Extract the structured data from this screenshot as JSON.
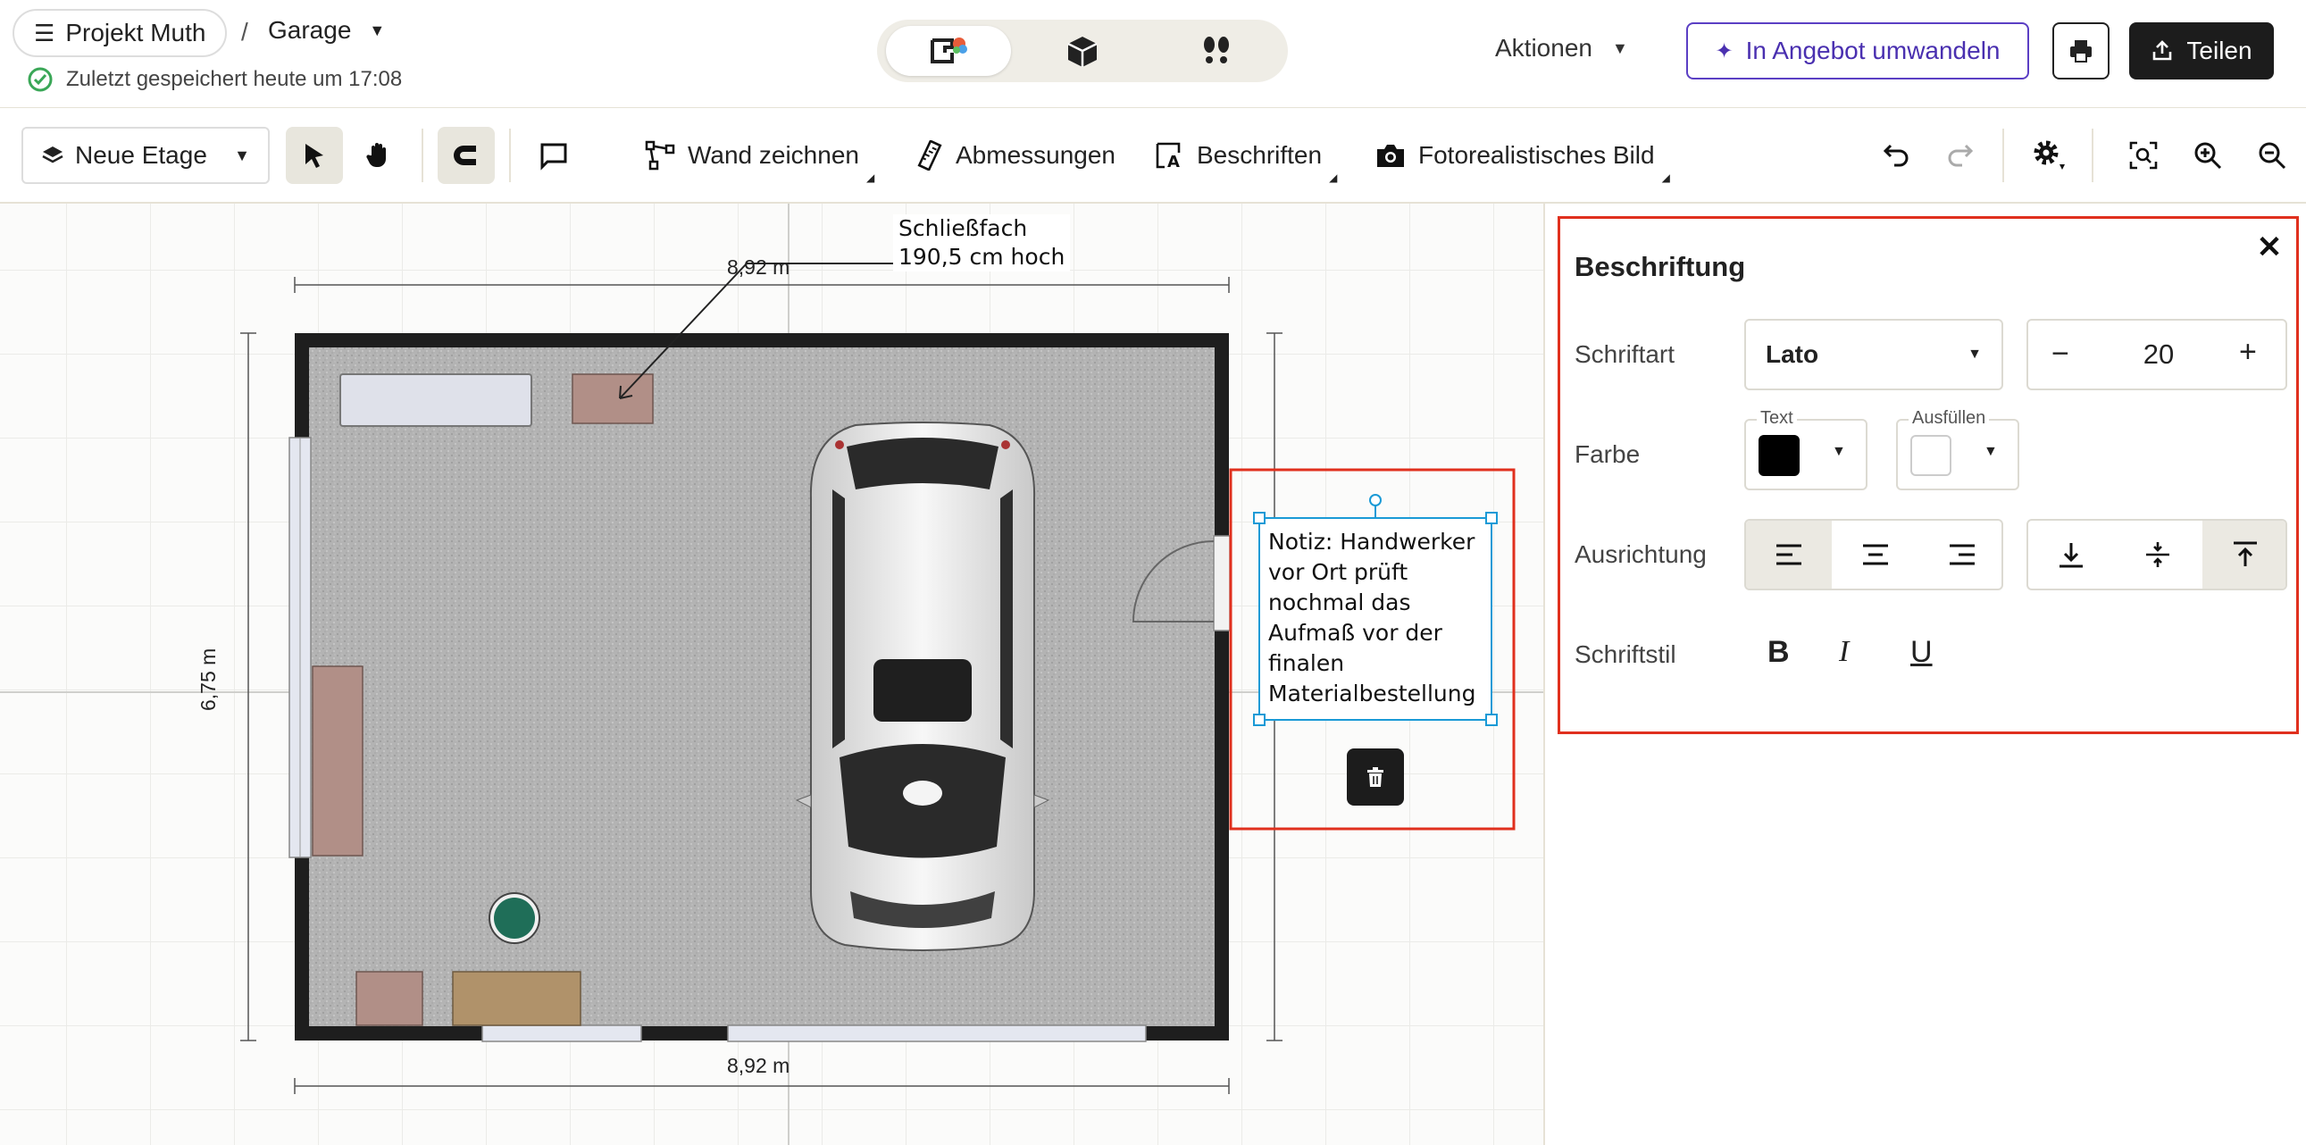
{
  "header": {
    "project": "Projekt Muth",
    "separator": "/",
    "room": "Garage",
    "save_status": "Zuletzt gespeichert heute um 17:08",
    "actions_label": "Aktionen",
    "convert_label": "In Angebot umwandeln",
    "share_label": "Teilen",
    "view_modes": [
      "2d-plan-icon",
      "3d-box-icon",
      "walk-footsteps-icon"
    ]
  },
  "toolbar": {
    "floor_label": "Neue Etage",
    "wall_label": "Wand zeichnen",
    "dimensions_label": "Abmessungen",
    "labels_label": "Beschriften",
    "photo_label": "Fotorealistisches Bild"
  },
  "canvas": {
    "dim_top": "8,92 m",
    "dim_bottom": "8,92 m",
    "dim_left": "6,75 m",
    "callout_line1": "Schließfach",
    "callout_line2": "190,5 cm hoch",
    "note_lines": [
      "Notiz: Handwerker",
      "vor Ort prüft",
      "nochmal das",
      "Aufmaß vor der",
      "finalen",
      "Materialbestellung"
    ]
  },
  "panel": {
    "title": "Beschriftung",
    "font_label": "Schriftart",
    "font_value": "Lato",
    "font_size": "20",
    "color_label": "Farbe",
    "text_color_caption": "Text",
    "fill_color_caption": "Ausfüllen",
    "text_color": "#000000",
    "fill_color": "#ffffff",
    "align_label": "Ausrichtung",
    "style_label": "Schriftstil",
    "bold_glyph": "B",
    "italic_glyph": "I",
    "underline_glyph": "U"
  },
  "colors": {
    "accent": "#5b3fc4",
    "selection": "#1a9ad6",
    "highlight_border": "#e0301e",
    "dark_button": "#1c1c1c",
    "status_ok": "#3aa757"
  }
}
